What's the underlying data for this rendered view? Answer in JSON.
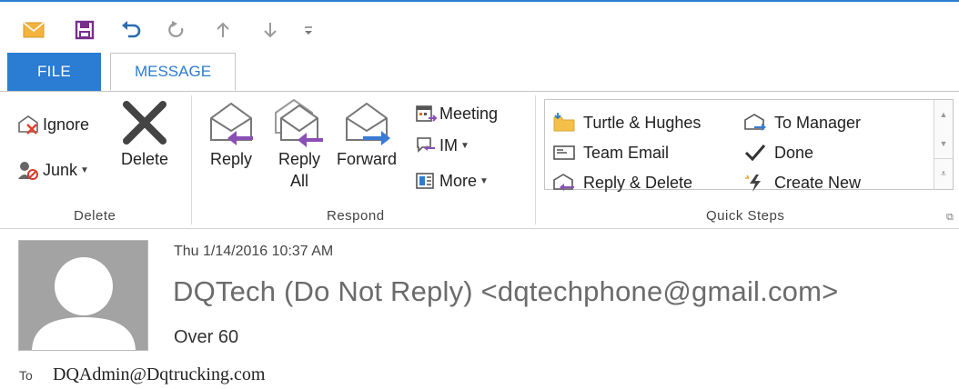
{
  "quick_access": {
    "icons": [
      "envelope-icon",
      "save-icon",
      "undo-icon",
      "redo-icon",
      "up-arrow-icon",
      "down-arrow-icon",
      "customize-icon"
    ]
  },
  "tabs": [
    {
      "label": "FILE"
    },
    {
      "label": "MESSAGE"
    }
  ],
  "ribbon": {
    "delete_group": {
      "label": "Delete",
      "ignore": "Ignore",
      "junk": "Junk",
      "delete": "Delete"
    },
    "respond_group": {
      "label": "Respond",
      "reply": "Reply",
      "reply_all_line1": "Reply",
      "reply_all_line2": "All",
      "forward": "Forward",
      "meeting": "Meeting",
      "im": "IM",
      "more": "More"
    },
    "quick_steps_group": {
      "label": "Quick Steps",
      "items": [
        {
          "label": "Turtle & Hughes",
          "icon": "folder-icon"
        },
        {
          "label": "To Manager",
          "icon": "envelope-forward-icon"
        },
        {
          "label": "Team Email",
          "icon": "email-icon"
        },
        {
          "label": "Done",
          "icon": "checkmark-icon"
        },
        {
          "label": "Reply & Delete",
          "icon": "reply-delete-icon"
        },
        {
          "label": "Create New",
          "icon": "lightning-icon"
        }
      ]
    }
  },
  "message": {
    "date": "Thu 1/14/2016 10:37 AM",
    "sender": "DQTech (Do Not Reply) <dqtechphone@gmail.com>",
    "subject": "Over 60",
    "to_label": "To",
    "to_value": "DQAdmin@Dqtrucking.com"
  },
  "colors": {
    "accent": "#2b7cd3",
    "reply_purple": "#8a4fb5",
    "forward_blue": "#3a7bd5"
  }
}
